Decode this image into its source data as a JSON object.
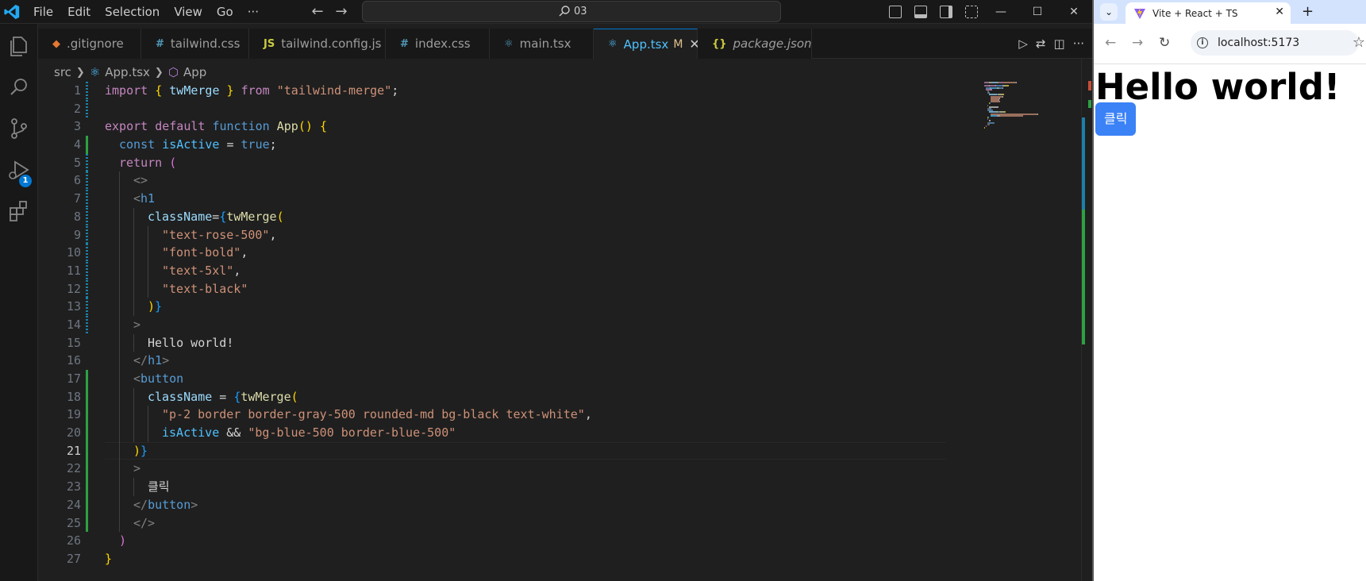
{
  "vscode": {
    "menus": [
      "File",
      "Edit",
      "Selection",
      "View",
      "Go",
      "···"
    ],
    "command_center": "03",
    "activity_badge": "1",
    "tabs": [
      {
        "icon": "◆",
        "icon_color": "#e37933",
        "label": ".gitignore",
        "active": false
      },
      {
        "icon": "#",
        "icon_color": "#519aba",
        "label": "tailwind.css",
        "active": false
      },
      {
        "icon": "JS",
        "icon_color": "#cbcb41",
        "label": "tailwind.config.js",
        "active": false
      },
      {
        "icon": "#",
        "icon_color": "#519aba",
        "label": "index.css",
        "active": false
      },
      {
        "icon": "⚛",
        "icon_color": "#519aba",
        "label": "main.tsx",
        "active": false
      },
      {
        "icon": "⚛",
        "icon_color": "#4fc1ff",
        "label": "App.tsx",
        "active": true,
        "modified": "M"
      },
      {
        "icon": "{}",
        "icon_color": "#cbcb41",
        "label": "package.json",
        "active": false
      }
    ],
    "breadcrumb": [
      "src",
      "App.tsx",
      "App"
    ],
    "code": {
      "current_line": 21,
      "lines": [
        {
          "n": "1",
          "g": "mod",
          "i": 0,
          "t": [
            [
              "import",
              "k"
            ],
            [
              " ",
              "p"
            ],
            [
              "{",
              "b1"
            ],
            [
              " twMerge ",
              "v"
            ],
            [
              "}",
              "b1"
            ],
            [
              " from ",
              "k"
            ],
            [
              "\"tailwind-merge\"",
              "s"
            ],
            [
              ";",
              "p"
            ]
          ]
        },
        {
          "n": "2",
          "g": "mod",
          "i": 0,
          "t": []
        },
        {
          "n": "3",
          "g": "",
          "i": 0,
          "t": [
            [
              "export",
              "k"
            ],
            [
              " ",
              "p"
            ],
            [
              "default",
              "k"
            ],
            [
              " ",
              "p"
            ],
            [
              "function",
              "kb"
            ],
            [
              " ",
              "p"
            ],
            [
              "App",
              "fn"
            ],
            [
              "()",
              "b1"
            ],
            [
              " ",
              "p"
            ],
            [
              "{",
              "b1"
            ]
          ]
        },
        {
          "n": "4",
          "g": "add",
          "i": 1,
          "t": [
            [
              "const",
              "kb"
            ],
            [
              " ",
              "p"
            ],
            [
              "isActive",
              "c"
            ],
            [
              " = ",
              "p"
            ],
            [
              "true",
              "kb"
            ],
            [
              ";",
              "p"
            ]
          ]
        },
        {
          "n": "5",
          "g": "mod",
          "i": 1,
          "t": [
            [
              "return",
              "k"
            ],
            [
              " ",
              "p"
            ],
            [
              "(",
              "b2"
            ]
          ]
        },
        {
          "n": "6",
          "g": "mod",
          "i": 2,
          "t": [
            [
              "<>",
              "t"
            ]
          ]
        },
        {
          "n": "7",
          "g": "mod",
          "i": 2,
          "t": [
            [
              "<",
              "t"
            ],
            [
              "h1",
              "tg"
            ]
          ]
        },
        {
          "n": "8",
          "g": "mod",
          "i": 3,
          "t": [
            [
              "className",
              "v"
            ],
            [
              "=",
              "p"
            ],
            [
              "{",
              "b3"
            ],
            [
              "twMerge",
              "fn"
            ],
            [
              "(",
              "b1"
            ]
          ]
        },
        {
          "n": "9",
          "g": "mod",
          "i": 4,
          "t": [
            [
              "\"text-rose-500\"",
              "s"
            ],
            [
              ",",
              "p"
            ]
          ]
        },
        {
          "n": "10",
          "g": "mod",
          "i": 4,
          "t": [
            [
              "\"font-bold\"",
              "s"
            ],
            [
              ",",
              "p"
            ]
          ]
        },
        {
          "n": "11",
          "g": "mod",
          "i": 4,
          "t": [
            [
              "\"text-5xl\"",
              "s"
            ],
            [
              ",",
              "p"
            ]
          ]
        },
        {
          "n": "12",
          "g": "mod",
          "i": 4,
          "t": [
            [
              "\"text-black\"",
              "s"
            ]
          ]
        },
        {
          "n": "13",
          "g": "mod",
          "i": 3,
          "t": [
            [
              ")",
              "b1"
            ],
            [
              "}",
              "b3"
            ]
          ]
        },
        {
          "n": "14",
          "g": "mod",
          "i": 2,
          "t": [
            [
              ">",
              "t"
            ]
          ]
        },
        {
          "n": "15",
          "g": "",
          "i": 3,
          "t": [
            [
              "Hello world!",
              "p"
            ]
          ]
        },
        {
          "n": "16",
          "g": "",
          "i": 2,
          "t": [
            [
              "</",
              "t"
            ],
            [
              "h1",
              "tg"
            ],
            [
              ">",
              "t"
            ]
          ]
        },
        {
          "n": "17",
          "g": "add",
          "i": 2,
          "t": [
            [
              "<",
              "t"
            ],
            [
              "button",
              "tg"
            ]
          ]
        },
        {
          "n": "18",
          "g": "add",
          "i": 3,
          "t": [
            [
              "className",
              "v"
            ],
            [
              " = ",
              "p"
            ],
            [
              "{",
              "b3"
            ],
            [
              "twMerge",
              "fn"
            ],
            [
              "(",
              "b1"
            ]
          ]
        },
        {
          "n": "19",
          "g": "add",
          "i": 4,
          "t": [
            [
              "\"p-2 border border-gray-500 rounded-md bg-black text-white\"",
              "s"
            ],
            [
              ",",
              "p"
            ]
          ]
        },
        {
          "n": "20",
          "g": "add",
          "i": 4,
          "t": [
            [
              "isActive",
              "c"
            ],
            [
              " && ",
              "p"
            ],
            [
              "\"bg-blue-500 border-blue-500\"",
              "s"
            ]
          ]
        },
        {
          "n": "21",
          "g": "add",
          "i": 2,
          "t": [
            [
              ")",
              "b1"
            ],
            [
              "}",
              "b3"
            ]
          ]
        },
        {
          "n": "22",
          "g": "add",
          "i": 2,
          "t": [
            [
              ">",
              "t"
            ]
          ]
        },
        {
          "n": "23",
          "g": "add",
          "i": 3,
          "t": [
            [
              "클릭",
              "p"
            ]
          ]
        },
        {
          "n": "24",
          "g": "add",
          "i": 2,
          "t": [
            [
              "</",
              "t"
            ],
            [
              "button",
              "tg"
            ],
            [
              ">",
              "t"
            ]
          ]
        },
        {
          "n": "25",
          "g": "add",
          "i": 2,
          "t": [
            [
              "</>",
              "t"
            ]
          ]
        },
        {
          "n": "26",
          "g": "",
          "i": 1,
          "t": [
            [
              ")",
              "b2"
            ]
          ]
        },
        {
          "n": "27",
          "g": "",
          "i": 0,
          "t": [
            [
              "}",
              "b1"
            ]
          ]
        }
      ]
    }
  },
  "browser": {
    "tab_title": "Vite + React + TS",
    "url": "localhost:5173",
    "page": {
      "heading": "Hello world!",
      "button_label": "클릭",
      "button_color": "#3b82f6"
    }
  }
}
